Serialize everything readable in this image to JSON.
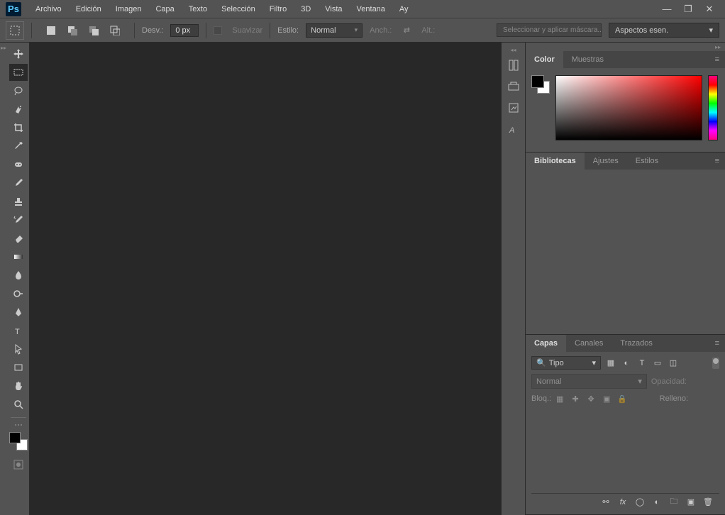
{
  "app": {
    "logo": "Ps"
  },
  "menu": [
    "Archivo",
    "Edición",
    "Imagen",
    "Capa",
    "Texto",
    "Selección",
    "Filtro",
    "3D",
    "Vista",
    "Ventana",
    "Ay"
  ],
  "options": {
    "desv_label": "Desv.:",
    "desv_value": "0 px",
    "suavizar": "Suavizar",
    "estilo_label": "Estilo:",
    "estilo_value": "Normal",
    "anch_label": "Anch.:",
    "alt_label": "Alt.:",
    "mask_btn": "Seleccionar y aplicar máscara...",
    "workspace": "Aspectos esen."
  },
  "panels": {
    "color": {
      "tabs": [
        "Color",
        "Muestras"
      ],
      "active": 0
    },
    "libs": {
      "tabs": [
        "Bibliotecas",
        "Ajustes",
        "Estilos"
      ],
      "active": 0
    },
    "layers": {
      "tabs": [
        "Capas",
        "Canales",
        "Trazados"
      ],
      "active": 0,
      "filter": "Tipo",
      "blend": "Normal",
      "opacity_label": "Opacidad:",
      "lock_label": "Bloq.:",
      "fill_label": "Relleno:"
    }
  },
  "tools": [
    "move",
    "marquee",
    "lasso",
    "quick-select",
    "crop",
    "eyedropper",
    "healing",
    "brush",
    "stamp",
    "history-brush",
    "eraser",
    "gradient",
    "blur",
    "dodge",
    "pen",
    "type",
    "path-select",
    "rectangle",
    "hand",
    "zoom"
  ]
}
